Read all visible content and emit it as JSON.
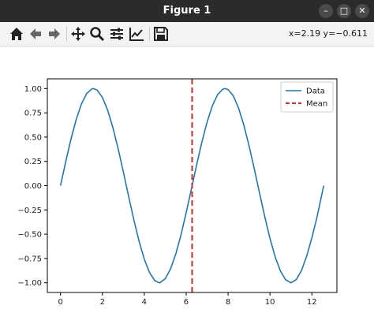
{
  "window": {
    "title": "Figure 1",
    "buttons": [
      {
        "name": "minimize-button",
        "glyph": "–"
      },
      {
        "name": "maximize-button",
        "glyph": "□"
      },
      {
        "name": "close-button",
        "glyph": "✕"
      }
    ]
  },
  "toolbar": {
    "tools": [
      {
        "name": "home-icon"
      },
      {
        "name": "back-arrow-icon"
      },
      {
        "name": "forward-arrow-icon"
      },
      {
        "name": "pan-move-icon"
      },
      {
        "name": "zoom-magnifier-icon"
      },
      {
        "name": "configure-subplots-icon"
      },
      {
        "name": "edit-axis-icon"
      },
      {
        "name": "save-floppy-icon"
      }
    ],
    "coordinates": "x=2.19 y=−0.611"
  },
  "chart_data": {
    "type": "line",
    "title": "",
    "xlabel": "",
    "ylabel": "",
    "xlim": [
      -0.628,
      13.195
    ],
    "ylim": [
      -1.1,
      1.1
    ],
    "xticks": [
      0,
      2,
      4,
      6,
      8,
      10,
      12
    ],
    "yticks": [
      -1.0,
      -0.75,
      -0.5,
      -0.25,
      0.0,
      0.25,
      0.5,
      0.75,
      1.0
    ],
    "ytick_labels": [
      "−1.00",
      "−0.75",
      "−0.50",
      "−0.25",
      "0.00",
      "0.25",
      "0.50",
      "0.75",
      "1.00"
    ],
    "grid": false,
    "legend_position": "upper right",
    "series": [
      {
        "name": "Data",
        "kind": "line",
        "color": "#1f77b4",
        "x": [
          0,
          0.25,
          0.5,
          0.75,
          1.0,
          1.25,
          1.5,
          1.5708,
          1.75,
          2.0,
          2.25,
          2.5,
          2.75,
          3.0,
          3.1416,
          3.25,
          3.5,
          3.75,
          4.0,
          4.25,
          4.5,
          4.7124,
          4.75,
          5.0,
          5.25,
          5.5,
          5.75,
          6.0,
          6.25,
          6.2832,
          6.5,
          6.75,
          7.0,
          7.25,
          7.5,
          7.75,
          7.854,
          8.0,
          8.25,
          8.5,
          8.75,
          9.0,
          9.25,
          9.4248,
          9.5,
          9.75,
          10.0,
          10.25,
          10.5,
          10.75,
          10.9956,
          11.0,
          11.25,
          11.5,
          11.75,
          12.0,
          12.25,
          12.5,
          12.5664
        ],
        "y": [
          0.0,
          0.247,
          0.479,
          0.682,
          0.841,
          0.949,
          0.997,
          1.0,
          0.984,
          0.909,
          0.778,
          0.598,
          0.382,
          0.141,
          0.0,
          -0.108,
          -0.351,
          -0.572,
          -0.757,
          -0.895,
          -0.978,
          -1.0,
          -0.999,
          -0.959,
          -0.859,
          -0.706,
          -0.508,
          -0.279,
          -0.033,
          0.0,
          0.215,
          0.45,
          0.657,
          0.823,
          0.938,
          0.994,
          1.0,
          0.989,
          0.925,
          0.798,
          0.624,
          0.412,
          0.174,
          0.0,
          -0.075,
          -0.319,
          -0.544,
          -0.736,
          -0.88,
          -0.97,
          -1.0,
          -1.0,
          -0.968,
          -0.876,
          -0.727,
          -0.537,
          -0.318,
          -0.066,
          0.0
        ]
      },
      {
        "name": "Mean",
        "kind": "vline",
        "color": "#d62728",
        "x_value": 6.2832,
        "linestyle": "dashed"
      }
    ]
  }
}
